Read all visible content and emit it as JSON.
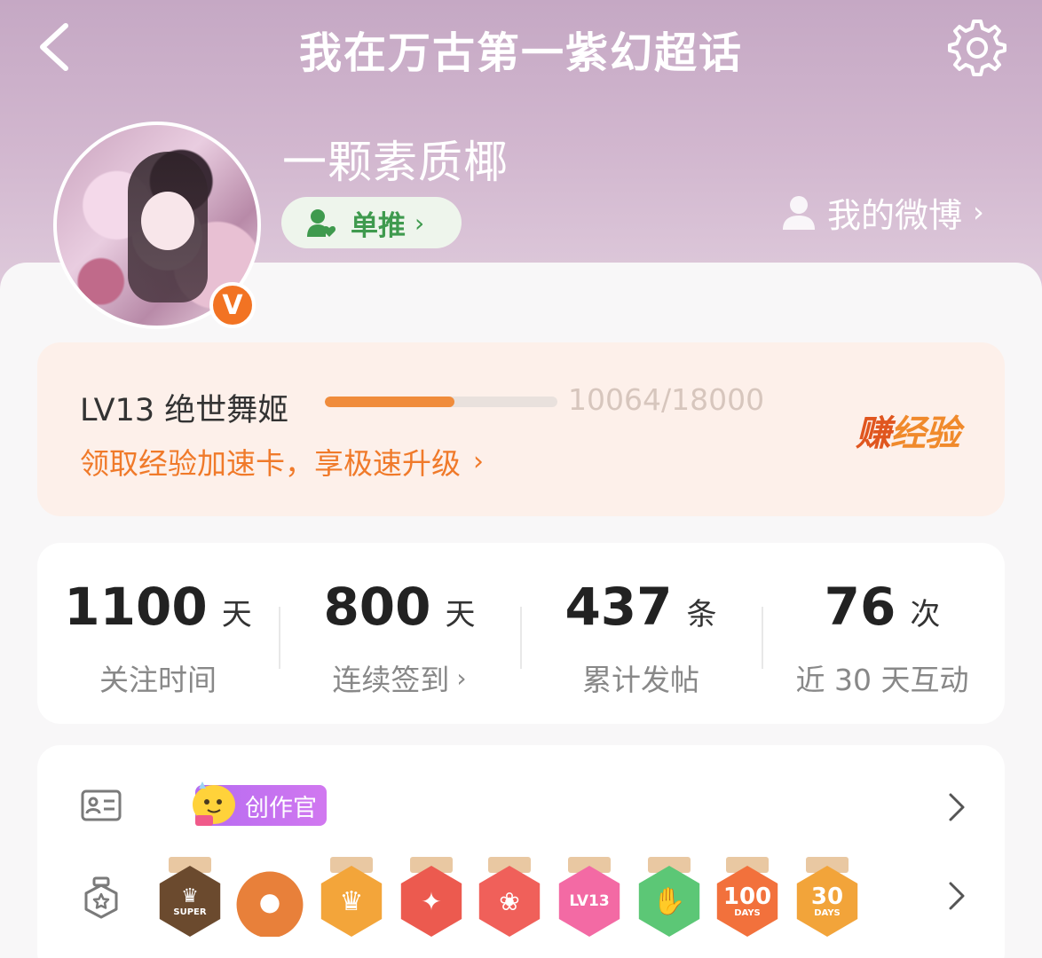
{
  "header": {
    "title": "我在万古第一紫幻超话"
  },
  "profile": {
    "username": "一颗素质椰",
    "verified_badge": "V",
    "role_button_label": "单推",
    "my_weibo_label": "我的微博"
  },
  "level": {
    "name": "LV13 绝世舞姬",
    "exp_text": "10064/18000",
    "exp_current": 10064,
    "exp_total": 18000,
    "tip": "领取经验加速卡，享极速升级",
    "earn_label_first": "赚",
    "earn_label_rest": "经验"
  },
  "stats": [
    {
      "value": "1100",
      "unit": "天",
      "label": "关注时间"
    },
    {
      "value": "800",
      "unit": "天",
      "label": "连续签到"
    },
    {
      "value": "437",
      "unit": "条",
      "label": "累计发帖"
    },
    {
      "value": "76",
      "unit": "次",
      "label": "近 30 天互动"
    }
  ],
  "badges": {
    "creator_tag": "创作官",
    "medals": [
      {
        "name": "super-crown",
        "text": "SUPER",
        "color": "#6b4a2e"
      },
      {
        "name": "orange-mascot",
        "text": "",
        "color": "#e8803a"
      },
      {
        "name": "gold-crown",
        "text": "",
        "color": "#f3a53a"
      },
      {
        "name": "dragon-red",
        "text": "",
        "color": "#ec5a4f"
      },
      {
        "name": "cat-red",
        "text": "",
        "color": "#f0605a"
      },
      {
        "name": "lv13-pink",
        "text": "LV13",
        "color": "#f36aa4"
      },
      {
        "name": "hand-green",
        "text": "",
        "color": "#5cc776"
      },
      {
        "name": "100-days",
        "text": "100",
        "sub": "DAYS",
        "color": "#f2713c"
      },
      {
        "name": "30-days",
        "text": "30",
        "sub": "DAYS",
        "color": "#f2a43a"
      }
    ]
  },
  "colors": {
    "accent_orange": "#f07a2a",
    "green": "#3f9a4e",
    "creator_purple": "#c06ff0"
  }
}
